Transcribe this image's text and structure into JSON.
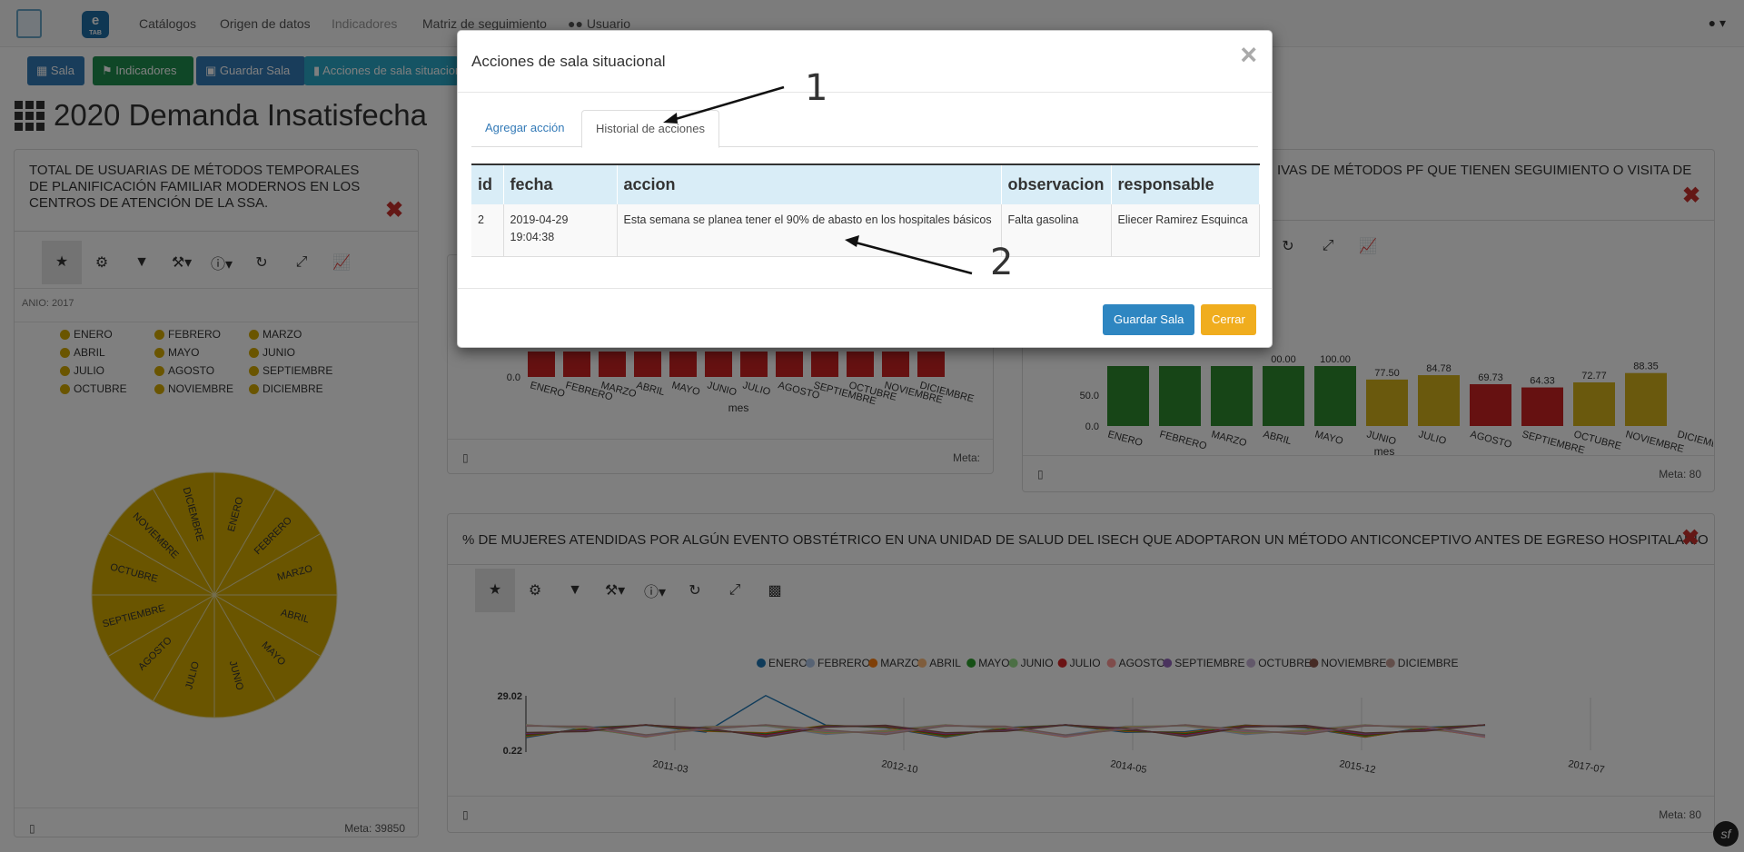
{
  "navbar": {
    "logo_text": "e",
    "logo_sub": "TAB",
    "items": [
      {
        "label": "Catálogos",
        "disabled": false
      },
      {
        "label": "Origen de datos",
        "disabled": false
      },
      {
        "label": "Indicadores",
        "disabled": true
      },
      {
        "label": "Matriz de seguimiento",
        "disabled": false
      },
      {
        "label": "Usuario",
        "disabled": false
      }
    ]
  },
  "toolbar": {
    "sala": "Sala",
    "indicadores": "Indicadores",
    "guardar_sala": "Guardar Sala",
    "acciones": "Acciones de sala situacional"
  },
  "page": {
    "title": "2020 Demanda Insatisfecha"
  },
  "panels": {
    "left": {
      "title": "TOTAL DE USUARIAS DE MÉTODOS TEMPORALES DE PLANIFICACIÓN FAMILIAR MODERNOS EN LOS CENTROS DE ATENCIÓN DE LA SSA.",
      "filter": "ANIO: 2017",
      "meta": "Meta: 39850"
    },
    "middle": {
      "meta": "Meta:",
      "xlabel": "mes"
    },
    "right": {
      "title": "IVAS DE MÉTODOS PF QUE TIENEN SEGUIMIENTO O VISITA DE",
      "meta": "Meta: 80",
      "xlabel": "mes"
    },
    "bottom": {
      "title": "% DE MUJERES ATENDIDAS POR ALGÚN EVENTO OBSTÉTRICO EN UNA UNIDAD DE SALUD DEL ISECH QUE ADOPTARON UN MÉTODO ANTICONCEPTIVO ANTES DE EGRESO HOSPITALARIO",
      "meta": "Meta: 80"
    }
  },
  "months": [
    "ENERO",
    "FEBRERO",
    "MARZO",
    "ABRIL",
    "MAYO",
    "JUNIO",
    "JULIO",
    "AGOSTO",
    "SEPTIEMBRE",
    "OCTUBRE",
    "NOVIEMBRE",
    "DICIEMBRE"
  ],
  "colors": {
    "pie": "#d4ab00",
    "green": "#2e8b2e",
    "yellow": "#d4b21a",
    "red": "#cc2222",
    "primary": "#337ab7",
    "success": "#1e8f4e",
    "info": "#2aa9c9",
    "warning": "#f0ad1e"
  },
  "chart_data": [
    {
      "type": "pie",
      "categories": [
        "ENERO",
        "FEBRERO",
        "MARZO",
        "ABRIL",
        "MAYO",
        "JUNIO",
        "JULIO",
        "AGOSTO",
        "SEPTIEMBRE",
        "OCTUBRE",
        "NOVIEMBRE",
        "DICIEMBRE"
      ],
      "values": [
        1,
        1,
        1,
        1,
        1,
        1,
        1,
        1,
        1,
        1,
        1,
        1
      ]
    },
    {
      "type": "bar",
      "categories": [
        "ENERO",
        "FEBRERO",
        "MARZO",
        "ABRIL",
        "MAYO",
        "JUNIO",
        "JULIO",
        "AGOSTO",
        "SEPTIEMBRE",
        "OCTUBRE",
        "NOVIEMBRE",
        "DICIEMBRE"
      ],
      "ytick": "0.0",
      "xlabel": "mes"
    },
    {
      "type": "bar",
      "categories": [
        "ENERO",
        "FEBRERO",
        "MARZO",
        "ABRIL",
        "MAYO",
        "JUNIO",
        "JULIO",
        "AGOSTO",
        "SEPTIEMBRE",
        "OCTUBRE",
        "NOVIEMBRE",
        "DICIEMBRE"
      ],
      "values": [
        100,
        100,
        100,
        100.0,
        100.0,
        77.5,
        84.78,
        69.73,
        64.33,
        72.77,
        88.35
      ],
      "visible_labels": [
        "",
        "",
        "",
        "00.00",
        "100.00",
        "77.50",
        "84.78",
        "69.73",
        "64.33",
        "72.77",
        "88.35"
      ],
      "yticks": [
        "0.0",
        "50.0"
      ],
      "xlabel": "mes"
    },
    {
      "type": "line",
      "series_names": [
        "ENERO",
        "FEBRERO",
        "MARZO",
        "ABRIL",
        "MAYO",
        "JUNIO",
        "JULIO",
        "AGOSTO",
        "SEPTIEMBRE",
        "OCTUBRE",
        "NOVIEMBRE",
        "DICIEMBRE"
      ],
      "xticks": [
        "2011-03",
        "2012-10",
        "2014-05",
        "2015-12",
        "2017-07"
      ],
      "yticks": [
        "29.02",
        "0.22"
      ]
    }
  ],
  "modal": {
    "title": "Acciones de sala situacional",
    "close": "×",
    "tabs": {
      "add": "Agregar acción",
      "history": "Historial de acciones"
    },
    "table": {
      "headers": {
        "id": "id",
        "fecha": "fecha",
        "accion": "accion",
        "observacion": "observacion",
        "responsable": "responsable"
      },
      "row": {
        "id": "2",
        "fecha_date": "2019-04-29",
        "fecha_time": "19:04:38",
        "accion": "Esta semana se planea tener el 90% de abasto en los hospitales básicos",
        "observacion": "Falta gasolina",
        "responsable": "Eliecer Ramirez Esquinca"
      }
    },
    "save": "Guardar Sala",
    "cancel": "Cerrar"
  },
  "annotations": {
    "one": "1",
    "two": "2"
  }
}
